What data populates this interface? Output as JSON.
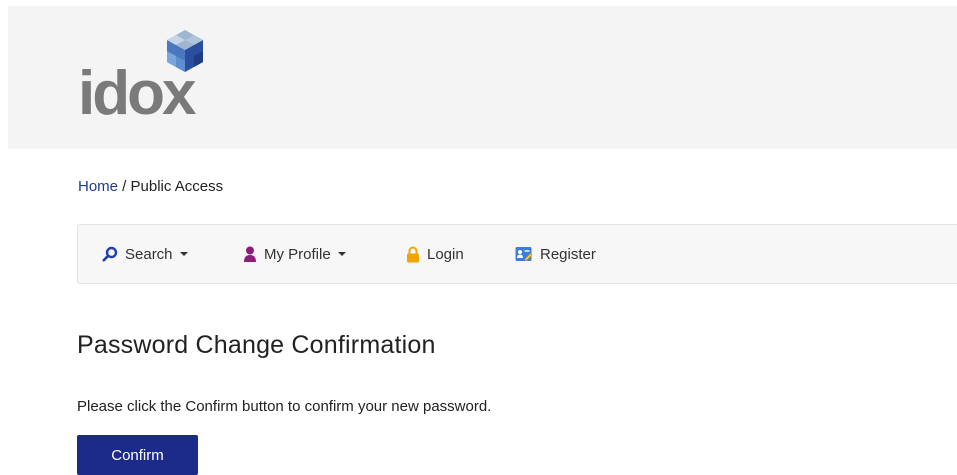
{
  "header": {
    "logo_text": "idox"
  },
  "breadcrumb": {
    "home_label": "Home",
    "separator": " / ",
    "current_label": "Public Access"
  },
  "nav": {
    "search_label": "Search",
    "profile_label": "My Profile",
    "login_label": "Login",
    "register_label": "Register"
  },
  "main": {
    "title": "Password Change Confirmation",
    "instruction": "Please click the Confirm button to confirm your new password.",
    "confirm_label": "Confirm"
  },
  "colors": {
    "header_bg": "#f4f4f4",
    "link": "#1f3a93",
    "button_bg": "#1c2a8a",
    "search_icon": "#1f3fb0",
    "profile_icon": "#8a1e7a",
    "login_icon": "#f0a500",
    "register_icon": "#3b7fd6"
  },
  "icons": {
    "logo": "cube-logo-icon",
    "search": "search-icon",
    "profile": "user-icon",
    "login": "lock-icon",
    "register": "register-card-icon"
  }
}
